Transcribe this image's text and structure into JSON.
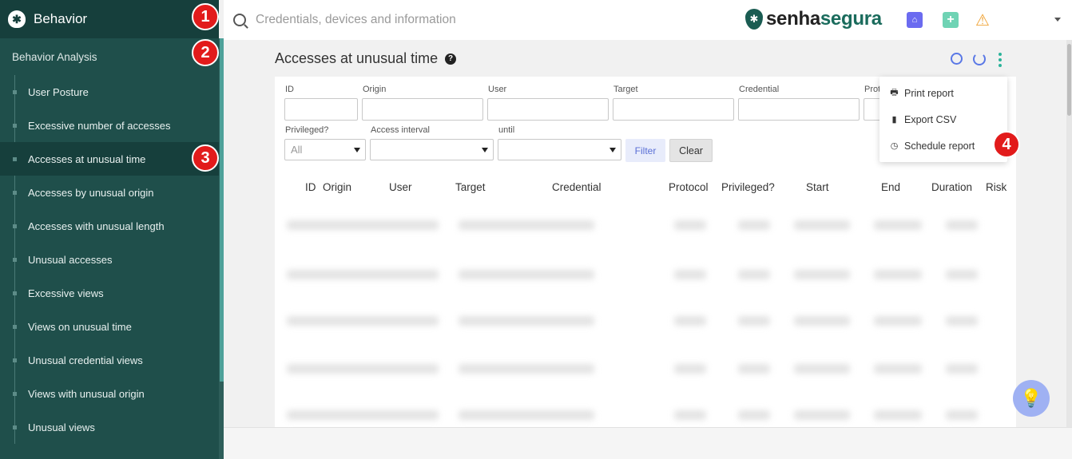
{
  "sidebar": {
    "title": "Behavior",
    "section": "Behavior Analysis",
    "items": [
      {
        "label": "User Posture"
      },
      {
        "label": "Excessive number of accesses"
      },
      {
        "label": "Accesses at unusual time"
      },
      {
        "label": "Accesses by unusual origin"
      },
      {
        "label": "Accesses with unusual length"
      },
      {
        "label": "Unusual accesses"
      },
      {
        "label": "Excessive views"
      },
      {
        "label": "Views on unusual time"
      },
      {
        "label": "Unusual credential views"
      },
      {
        "label": "Views with unusual origin"
      },
      {
        "label": "Unusual views"
      }
    ]
  },
  "topbar": {
    "search_placeholder": "Credentials, devices and information",
    "brand_part1": "senha",
    "brand_part2": "segura",
    "icons": [
      "home-icon",
      "add-icon",
      "warning-icon",
      "chevron-down-icon"
    ]
  },
  "main": {
    "title": "Accesses at unusual time",
    "filters": {
      "id": "ID",
      "origin": "Origin",
      "user": "User",
      "target": "Target",
      "credential": "Credential",
      "protocol_partial": "Prot",
      "privileged": "Privileged?",
      "privileged_value": "All",
      "access_interval": "Access interval",
      "until": "until",
      "filter_button": "Filter",
      "clear_button": "Clear"
    },
    "columns": [
      "ID",
      "Origin",
      "User",
      "Target",
      "Credential",
      "Protocol",
      "Privileged?",
      "Start",
      "End",
      "Duration",
      "Risk"
    ]
  },
  "menu": {
    "items": [
      {
        "label": "Print report",
        "icon": "print-icon"
      },
      {
        "label": "Export CSV",
        "icon": "file-icon"
      },
      {
        "label": "Schedule report",
        "icon": "clock-icon"
      }
    ]
  },
  "callouts": [
    "1",
    "2",
    "3",
    "4"
  ],
  "colors": {
    "sidebar_bg": "#1f4f4b",
    "sidebar_header": "#163f3c",
    "accent": "#2bb39a",
    "callout": "#e21b1b",
    "action_blue": "#5a78e6"
  }
}
